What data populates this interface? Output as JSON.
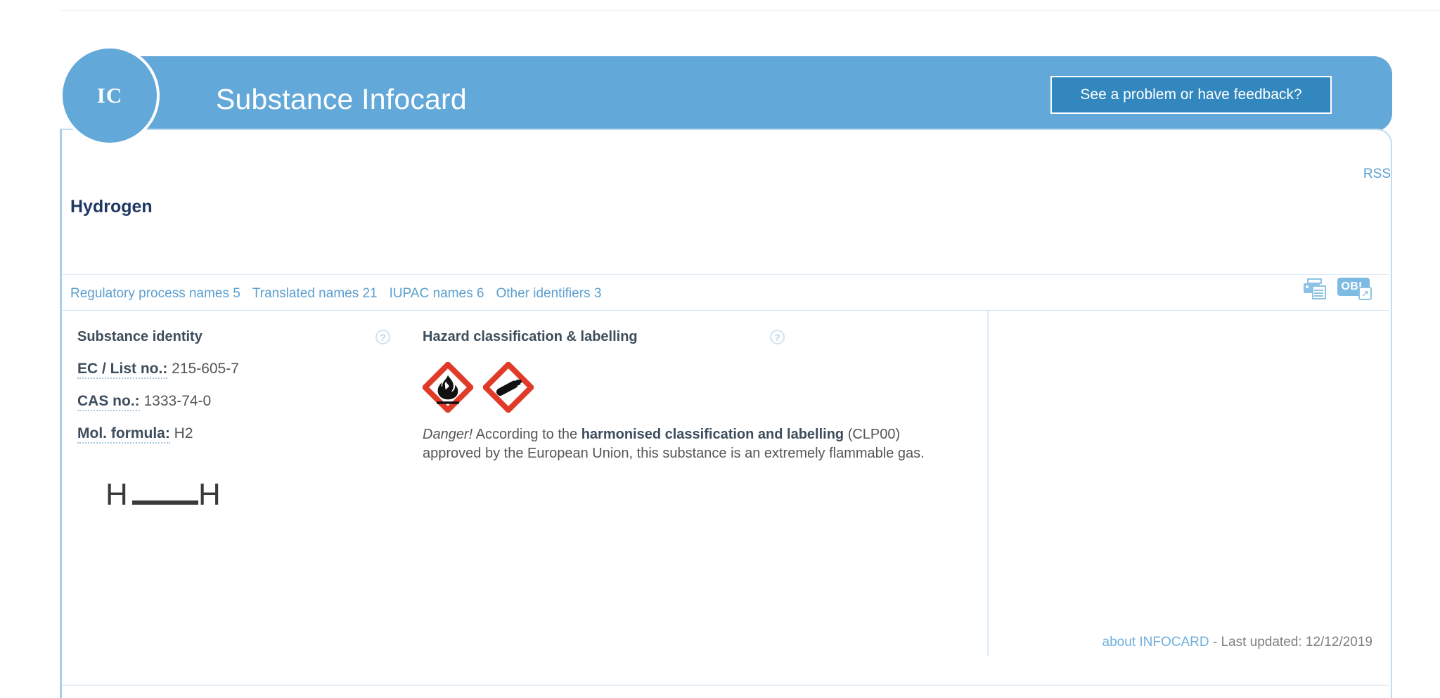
{
  "header": {
    "badge_label": "IC",
    "title": "Substance Infocard",
    "feedback_button": "See a problem or have feedback?"
  },
  "card": {
    "rss_label": "RSS",
    "substance_name": "Hydrogen",
    "name_links": [
      {
        "label": "Regulatory process names 5"
      },
      {
        "label": "Translated names 21"
      },
      {
        "label": "IUPAC names 6"
      },
      {
        "label": "Other identifiers 3"
      }
    ],
    "tools": {
      "print_icon": "printer-icon",
      "obl_label": "OBL",
      "obl_external": "↗"
    },
    "meta": {
      "about_link": "about INFOCARD",
      "last_updated": " - Last updated: 12/12/2019"
    }
  },
  "identity": {
    "heading": "Substance identity",
    "help": "?",
    "rows": [
      {
        "label": "EC / List no.:",
        "value": " 215-605-7"
      },
      {
        "label": "CAS no.:",
        "value": " 1333-74-0"
      },
      {
        "label": "Mol. formula:",
        "value": " H2"
      }
    ],
    "molecule": {
      "left_atom": "H",
      "right_atom": "H"
    }
  },
  "hazard": {
    "heading": "Hazard classification & labelling",
    "help": "?",
    "pictograms": [
      {
        "name": "ghs02-flammable-pictogram"
      },
      {
        "name": "ghs04-gas-cylinder-pictogram"
      }
    ],
    "statement": {
      "danger": "Danger!",
      "part1": " According to the ",
      "bold": "harmonised classification and labelling",
      "part2": " (CLP00) approved by the European Union, this substance is an extremely flammable gas."
    }
  },
  "colors": {
    "brand_blue": "#62a8d9",
    "button_blue": "#3287bf",
    "link_blue": "#5b9fd0",
    "heading_navy": "#1f3864",
    "hazard_red": "#e03a29"
  }
}
